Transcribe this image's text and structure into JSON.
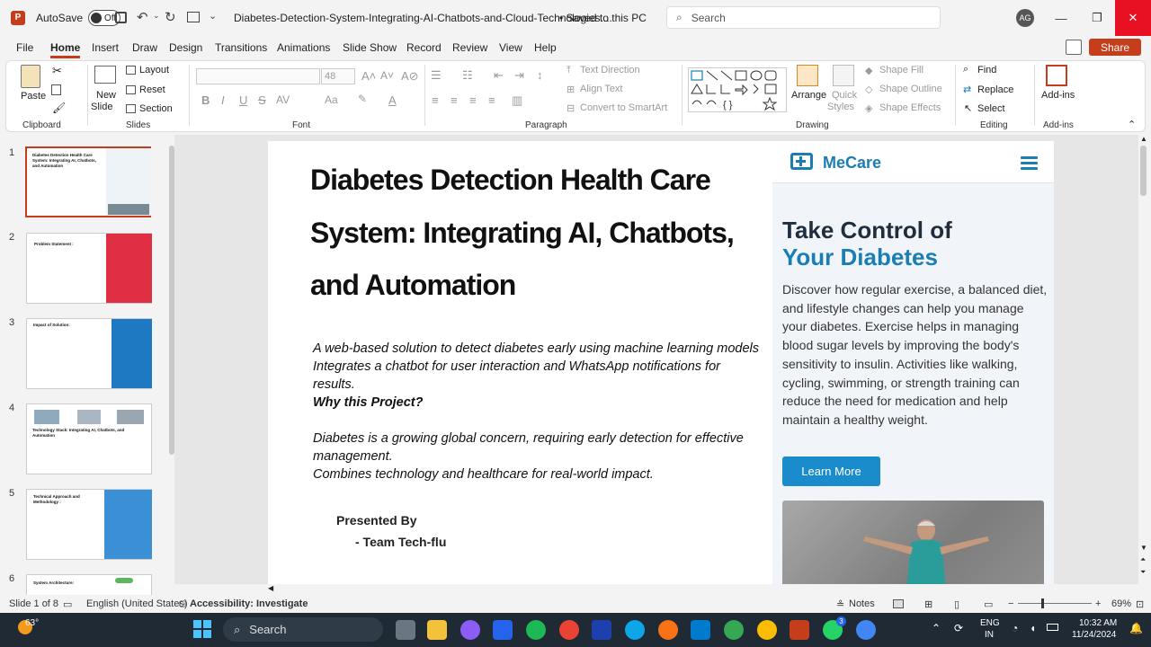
{
  "titlebar": {
    "autosave_label": "AutoSave",
    "autosave_state": "Off",
    "document_title": "Diabetes-Detection-System-Integrating-AI-Chatbots-and-Cloud-Technologies....",
    "save_status": "• Saved to this PC",
    "search_placeholder": "Search",
    "user_initials": "AG"
  },
  "menu": {
    "items": [
      "File",
      "Home",
      "Insert",
      "Draw",
      "Design",
      "Transitions",
      "Animations",
      "Slide Show",
      "Record",
      "Review",
      "View",
      "Help"
    ],
    "share_label": "Share"
  },
  "ribbon": {
    "clipboard": {
      "paste": "Paste",
      "group": "Clipboard"
    },
    "slides": {
      "new_slide_1": "New",
      "new_slide_2": "Slide",
      "layout": "Layout",
      "reset": "Reset",
      "section": "Section",
      "group": "Slides"
    },
    "font": {
      "size": "48",
      "group": "Font",
      "bold": "B",
      "italic": "I",
      "underline": "U",
      "strike": "S"
    },
    "paragraph": {
      "text_direction": "Text Direction",
      "align_text": "Align Text",
      "smartart": "Convert to SmartArt",
      "group": "Paragraph"
    },
    "drawing": {
      "arrange": "Arrange",
      "quick_styles_1": "Quick",
      "quick_styles_2": "Styles",
      "shape_fill": "Shape Fill",
      "shape_outline": "Shape Outline",
      "shape_effects": "Shape Effects",
      "group": "Drawing"
    },
    "editing": {
      "find": "Find",
      "replace": "Replace",
      "select": "Select",
      "group": "Editing"
    },
    "addins": {
      "label": "Add-ins",
      "group": "Add-ins"
    }
  },
  "thumbnails": [
    {
      "num": "1",
      "title": "Diabetes Detection Health Care System: Integrating AI, Chatbots, and Automation"
    },
    {
      "num": "2",
      "title": "Problem Statement :"
    },
    {
      "num": "3",
      "title": "Impact of Solution:"
    },
    {
      "num": "4",
      "title": "Technology Stack: Integrating AI, Chatbots, and Automation"
    },
    {
      "num": "5",
      "title": "Technical Approach and Methodology :"
    },
    {
      "num": "6",
      "title": "System Architecture:"
    }
  ],
  "slide": {
    "title_l1": "Diabetes Detection Health Care",
    "title_l2": "System: Integrating AI, Chatbots,",
    "title_l3": "and Automation",
    "body_l1": "A web-based solution to detect diabetes early using machine learning models",
    "body_l2": "Integrates a chatbot for user interaction and WhatsApp notifications for results.",
    "body_l3": "Why this Project?",
    "body_l4": "Diabetes is a growing global concern, requiring early detection for effective management.",
    "body_l5": "Combines technology and healthcare for real-world impact.",
    "presented": "Presented By",
    "team": "- Team Tech-flu",
    "web": {
      "brand": "MeCare",
      "heading_1": "Take Control of",
      "heading_2": "Your Diabetes",
      "text": "Discover how regular exercise, a balanced diet, and lifestyle changes can help you manage your diabetes. Exercise helps in managing blood sugar levels by improving the body's sensitivity to insulin. Activities like walking, cycling, swimming, or strength training can reduce the need for medication and help maintain a healthy weight.",
      "button": "Learn More"
    }
  },
  "statusbar": {
    "slide_count": "Slide 1 of 8",
    "language": "English (United States)",
    "accessibility": "Accessibility: Investigate",
    "notes": "Notes",
    "zoom": "69%"
  },
  "taskbar": {
    "weather": "63°",
    "search_placeholder": "Search",
    "lang_1": "ENG",
    "lang_2": "IN",
    "time": "10:32 AM",
    "date": "11/24/2024",
    "whatsapp_badge": "3"
  }
}
